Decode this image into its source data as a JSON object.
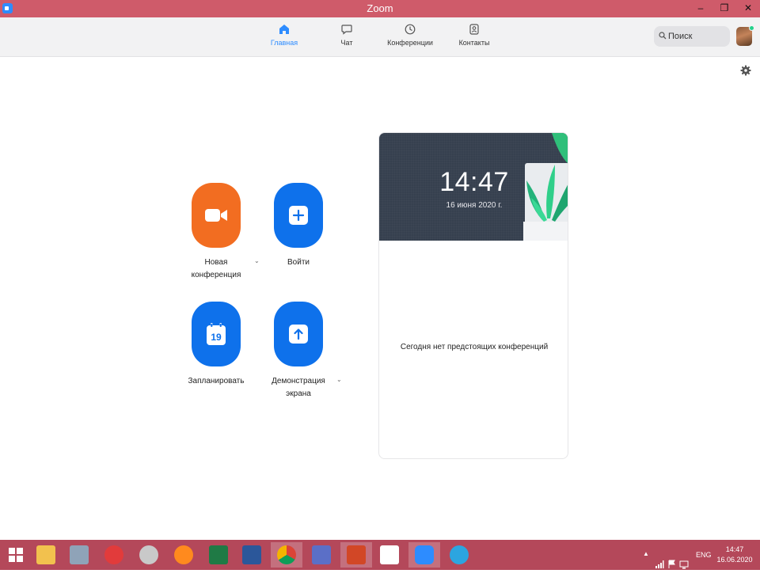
{
  "window": {
    "title": "Zoom",
    "minimize": "–",
    "restore": "❐",
    "close": "✕"
  },
  "nav": {
    "tabs": [
      {
        "label": "Главная",
        "icon": "home-icon",
        "active": true
      },
      {
        "label": "Чат",
        "icon": "chat-icon",
        "active": false
      },
      {
        "label": "Конференции",
        "icon": "clock-icon",
        "active": false
      },
      {
        "label": "Контакты",
        "icon": "contacts-icon",
        "active": false
      }
    ],
    "search_placeholder": "Поиск",
    "accent": "#2d8cff"
  },
  "actions": {
    "new_meeting": {
      "line1": "Новая",
      "line2": "конференция"
    },
    "join": {
      "label": "Войти"
    },
    "schedule": {
      "label": "Запланировать",
      "day": "19"
    },
    "share": {
      "line1": "Демонстрация",
      "line2": "экрана"
    },
    "caret": "⌄"
  },
  "calendar": {
    "time": "14:47",
    "date": "16 июня 2020 г.",
    "empty_message": "Сегодня нет предстоящих конференций"
  },
  "taskbar": {
    "lang": "ENG",
    "time": "14:47",
    "date": "16.06.2020"
  },
  "colors": {
    "titlebar": "#cf5b6a",
    "taskbar": "#b4485a",
    "orange": "#f26d21",
    "blue": "#0e71eb"
  }
}
